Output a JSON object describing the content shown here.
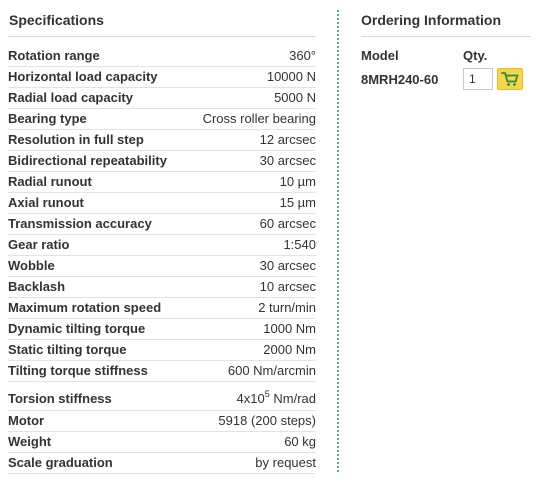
{
  "specifications": {
    "title": "Specifications",
    "rows": [
      {
        "label": "Rotation range",
        "value": "360°"
      },
      {
        "label": "Horizontal load capacity",
        "value": "10000 N"
      },
      {
        "label": "Radial load capacity",
        "value": "5000 N"
      },
      {
        "label": "Bearing type",
        "value": "Cross roller bearing"
      },
      {
        "label": "Resolution in full step",
        "value": "12 arcsec"
      },
      {
        "label": "Bidirectional repeatability",
        "value": "30 arcsec"
      },
      {
        "label": "Radial runout",
        "value": "10 µm"
      },
      {
        "label": "Axial runout",
        "value": "15 µm"
      },
      {
        "label": "Transmission accuracy",
        "value": "60 arcsec"
      },
      {
        "label": "Gear ratio",
        "value": "1:540"
      },
      {
        "label": "Wobble",
        "value": "30 arcsec"
      },
      {
        "label": "Backlash",
        "value": "10 arcsec"
      },
      {
        "label": "Maximum rotation speed",
        "value": "2 turn/min"
      },
      {
        "label": "Dynamic tilting torque",
        "value": "1000 Nm"
      },
      {
        "label": "Static tilting torque",
        "value": "2000 Nm"
      },
      {
        "label": "Tilting torque stiffness",
        "value": "600 Nm/arcmin"
      }
    ],
    "torsion": {
      "label": "Torsion stiffness",
      "value_base": "4x10",
      "value_exp": "5",
      "value_unit": " Nm/rad"
    },
    "rows_after": [
      {
        "label": "Motor",
        "value": "5918 (200 steps)"
      },
      {
        "label": "Weight",
        "value": "60 kg"
      },
      {
        "label": "Scale graduation",
        "value": "by request"
      }
    ]
  },
  "ordering": {
    "title": "Ordering Information",
    "model_header": "Model",
    "qty_header": "Qty.",
    "model": "8MRH240-60",
    "qty_value": "1",
    "cart_icon": "cart-icon",
    "cart_color": "#f5d54c"
  }
}
